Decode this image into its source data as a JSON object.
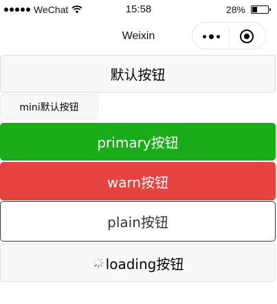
{
  "status_bar": {
    "carrier": "WeChat",
    "time": "15:58",
    "battery_percent": "28%",
    "battery_level": 0.28
  },
  "nav": {
    "title": "Weixin"
  },
  "buttons": {
    "default_label": "默认按钮",
    "mini_label": "mini默认按钮",
    "primary_label": "primary按钮",
    "warn_label": "warn按钮",
    "plain_label": "plain按钮",
    "loading_label": "loading按钮"
  },
  "colors": {
    "primary": "#1aad19",
    "warn": "#e64340",
    "default_bg": "#f8f8f8",
    "plain_border": "#353535"
  },
  "icons": {
    "signal": "signal-dots-icon",
    "wifi": "wifi-icon",
    "battery": "battery-icon",
    "menu": "more-dots-icon",
    "close": "target-circle-icon",
    "loading": "loading-spinner-icon"
  }
}
